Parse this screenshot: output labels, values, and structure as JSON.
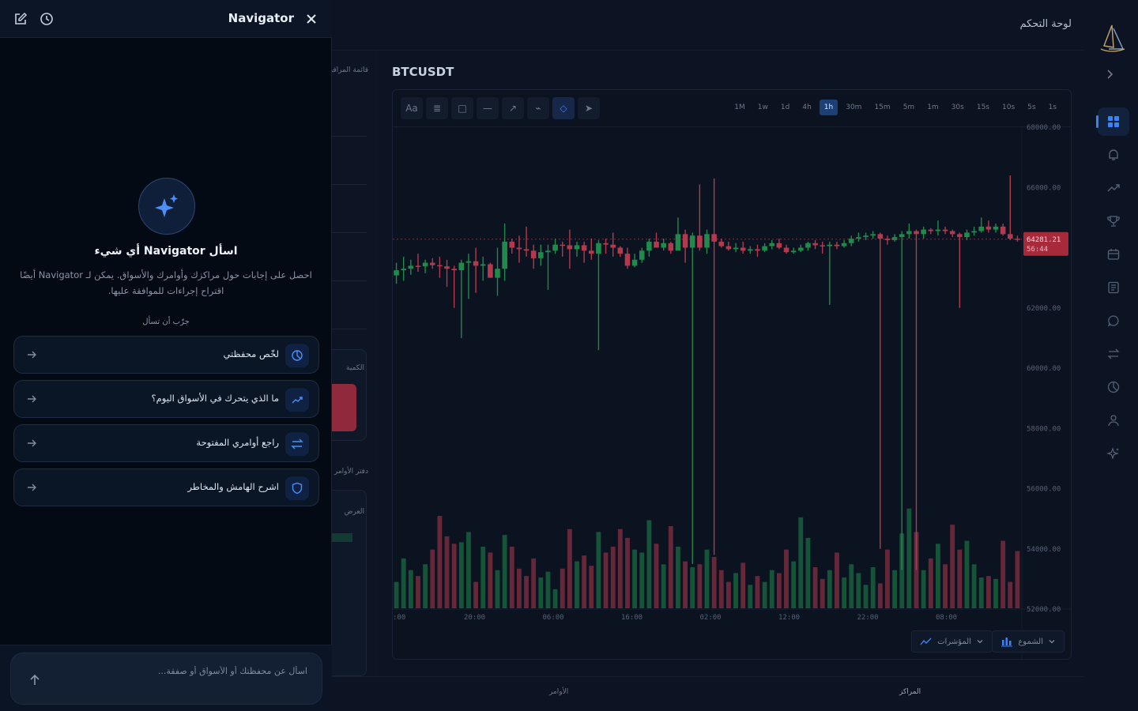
{
  "header": {
    "page_title": "لوحة التحكم"
  },
  "nav_icons": [
    "logo-icon",
    "dashboard-icon",
    "bell-icon",
    "trending-icon",
    "trophy-icon",
    "calendar-icon",
    "news-icon",
    "chat-icon",
    "transfer-icon",
    "portfolio-icon",
    "user-icon",
    "sparkles-icon"
  ],
  "left_column": {
    "watchlist_label": "قائمة المراقبة",
    "quantity_label": "الكمية",
    "orderbook_label": "دفتر الأوامر",
    "ask_label": "العرض"
  },
  "chart": {
    "symbol": "BTCUSDT",
    "tools": [
      "Aa",
      "≣",
      "□",
      "—",
      "↗",
      "⌁",
      "◇",
      "➤"
    ],
    "intervals": [
      "1M",
      "1w",
      "1d",
      "4h",
      "1h",
      "30m",
      "15m",
      "5m",
      "1m",
      "30s",
      "15s",
      "10s",
      "5s",
      "1s"
    ],
    "active_interval": "1h",
    "price_tag": "64281.21",
    "countdown": "56:44",
    "candles_label": "الشموع",
    "indicators_label": "المؤشرات",
    "colors": {
      "up": "#1f8a4c",
      "down": "#b23a4e",
      "price_tag": "#a8293a"
    }
  },
  "bottom_tabs": {
    "positions": "المراكز",
    "orders": "الأوامر"
  },
  "navigator": {
    "title": "Navigator",
    "hero_title": "اسأل Navigator أي شيء",
    "hero_subtitle": "احصل على إجابات حول مراكزك وأوامرك والأسواق. يمكن لـ Navigator أيضًا اقتراح إجراءات للموافقة عليها.",
    "try_label": "جرّب أن تسأل",
    "suggestions": [
      {
        "label": "لخّص محفظتي",
        "icon": "pie-icon"
      },
      {
        "label": "ما الذي يتحرك في الأسواق اليوم؟",
        "icon": "trending-icon"
      },
      {
        "label": "راجع أوامري المفتوحة",
        "icon": "transfer-icon"
      },
      {
        "label": "اشرح الهامش والمخاطر",
        "icon": "shield-icon"
      }
    ],
    "composer_placeholder": "اسأل عن محفظتك أو الأسواق أو صفقة..."
  },
  "chart_data": {
    "type": "candlestick",
    "title": "BTCUSDT",
    "y_ticks": [
      "68000.00",
      "66000.00",
      "64000.00",
      "62000.00",
      "60000.00",
      "58000.00",
      "56000.00",
      "54000.00",
      "52000.00"
    ],
    "ylim": [
      52000,
      68000
    ],
    "x_ticks": [
      ":00",
      "20:00",
      "06:00",
      "16:00",
      "02:00",
      "12:00",
      "22:00",
      "08:00"
    ],
    "last_price": 64281.21,
    "candles": [
      [
        63080,
        63250,
        62800,
        63500
      ],
      [
        63250,
        63300,
        62900,
        63700
      ],
      [
        63300,
        63400,
        63100,
        63600
      ],
      [
        63400,
        63380,
        63200,
        63800
      ],
      [
        63380,
        63500,
        63150,
        63600
      ],
      [
        63500,
        63420,
        63300,
        63650
      ],
      [
        63420,
        63380,
        63000,
        63700
      ],
      [
        63380,
        63300,
        62700,
        63600
      ],
      [
        63300,
        63250,
        62000,
        63400
      ],
      [
        63250,
        63500,
        61000,
        63600
      ],
      [
        63500,
        63550,
        62300,
        63800
      ],
      [
        63550,
        63400,
        62500,
        64000
      ],
      [
        63400,
        63450,
        62900,
        63700
      ],
      [
        63450,
        63000,
        63000,
        63500
      ],
      [
        63000,
        63300,
        62400,
        64000
      ],
      [
        63300,
        64200,
        62900,
        64800
      ],
      [
        64200,
        64000,
        63800,
        64300
      ],
      [
        64000,
        63950,
        63500,
        64400
      ],
      [
        63950,
        63900,
        63700,
        64700
      ],
      [
        63900,
        63650,
        63300,
        64100
      ],
      [
        63650,
        63850,
        63400,
        64100
      ],
      [
        63850,
        63900,
        62600,
        64100
      ],
      [
        63900,
        64100,
        63800,
        64300
      ],
      [
        64100,
        64080,
        63700,
        64200
      ],
      [
        64080,
        63950,
        63300,
        64600
      ],
      [
        63950,
        64080,
        63700,
        64200
      ],
      [
        64080,
        63900,
        63500,
        64200
      ],
      [
        63900,
        63800,
        63600,
        64300
      ],
      [
        63800,
        64150,
        60600,
        64250
      ],
      [
        64150,
        64100,
        63800,
        64300
      ],
      [
        64100,
        64000,
        63700,
        64500
      ],
      [
        64000,
        63800,
        63700,
        64050
      ],
      [
        63800,
        63400,
        63300,
        64000
      ],
      [
        63400,
        63600,
        63350,
        63800
      ],
      [
        63600,
        63900,
        63500,
        64000
      ],
      [
        63900,
        64200,
        63700,
        64300
      ],
      [
        64200,
        64000,
        64000,
        64500
      ],
      [
        64000,
        64150,
        63900,
        64300
      ],
      [
        64150,
        63900,
        63800,
        64200
      ],
      [
        63900,
        64450,
        64000,
        65000
      ],
      [
        64450,
        64000,
        63500,
        64600
      ],
      [
        64000,
        64400,
        53500,
        64500
      ],
      [
        64400,
        64000,
        63900,
        66100
      ],
      [
        64000,
        64450,
        63800,
        64600
      ],
      [
        64450,
        64200,
        53800,
        66300
      ],
      [
        64200,
        64050,
        64000,
        64300
      ],
      [
        64050,
        63950,
        63900,
        64200
      ],
      [
        63950,
        64000,
        63850,
        64150
      ],
      [
        64000,
        63900,
        63800,
        64200
      ],
      [
        63900,
        63950,
        63800,
        64050
      ],
      [
        63950,
        63900,
        63700,
        64100
      ],
      [
        63900,
        64050,
        63850,
        64150
      ],
      [
        64050,
        64150,
        63950,
        64250
      ],
      [
        64150,
        64000,
        63950,
        64300
      ],
      [
        64000,
        63850,
        63800,
        64100
      ],
      [
        63850,
        63900,
        63800,
        64000
      ],
      [
        63900,
        64000,
        63850,
        64100
      ],
      [
        64000,
        64150,
        63900,
        64200
      ],
      [
        64150,
        64080,
        63950,
        64250
      ],
      [
        64080,
        64050,
        63800,
        64200
      ],
      [
        64050,
        64100,
        62100,
        64200
      ],
      [
        64100,
        64050,
        63950,
        64200
      ],
      [
        64050,
        64150,
        64000,
        64250
      ],
      [
        64150,
        64300,
        64050,
        64400
      ],
      [
        64300,
        64350,
        64200,
        64500
      ],
      [
        64350,
        64400,
        64250,
        64500
      ],
      [
        64400,
        64450,
        64300,
        64550
      ],
      [
        64450,
        64300,
        54000,
        64500
      ],
      [
        64300,
        64250,
        64100,
        64400
      ],
      [
        64250,
        64350,
        64200,
        64450
      ],
      [
        64350,
        64450,
        53300,
        64550
      ],
      [
        64450,
        64550,
        64300,
        64800
      ],
      [
        64550,
        64450,
        53300,
        64600
      ],
      [
        64450,
        64600,
        64300,
        64700
      ],
      [
        64600,
        64550,
        64450,
        64650
      ],
      [
        64550,
        64600,
        64400,
        64900
      ],
      [
        64600,
        64550,
        64450,
        64700
      ],
      [
        64550,
        64450,
        64350,
        64600
      ],
      [
        64450,
        64350,
        62000,
        64500
      ],
      [
        64350,
        64500,
        64250,
        64600
      ],
      [
        64500,
        64550,
        64400,
        64700
      ],
      [
        64550,
        64700,
        64500,
        65000
      ],
      [
        64700,
        64600,
        64500,
        64900
      ],
      [
        64600,
        64700,
        64500,
        64800
      ],
      [
        64700,
        64450,
        64400,
        64800
      ],
      [
        64450,
        64300,
        64250,
        66400
      ],
      [
        64300,
        64281,
        64200,
        64400
      ]
    ],
    "volumes": [
      18,
      34,
      26,
      22,
      30,
      40,
      63,
      49,
      44,
      45,
      52,
      18,
      42,
      38,
      26,
      50,
      42,
      27,
      22,
      34,
      21,
      25,
      13,
      27,
      54,
      32,
      36,
      29,
      52,
      38,
      42,
      54,
      48,
      40,
      38,
      60,
      44,
      30,
      56,
      42,
      32,
      28,
      30,
      40,
      35,
      26,
      18,
      24,
      31,
      16,
      22,
      18,
      26,
      24,
      40,
      32,
      62,
      48,
      28,
      20,
      26,
      38,
      21,
      30,
      24,
      16,
      28,
      17,
      40,
      26,
      51,
      68,
      52,
      26,
      34,
      44,
      30,
      57,
      40,
      46,
      30,
      21,
      22,
      20,
      46,
      18,
      39,
      28,
      48
    ]
  }
}
